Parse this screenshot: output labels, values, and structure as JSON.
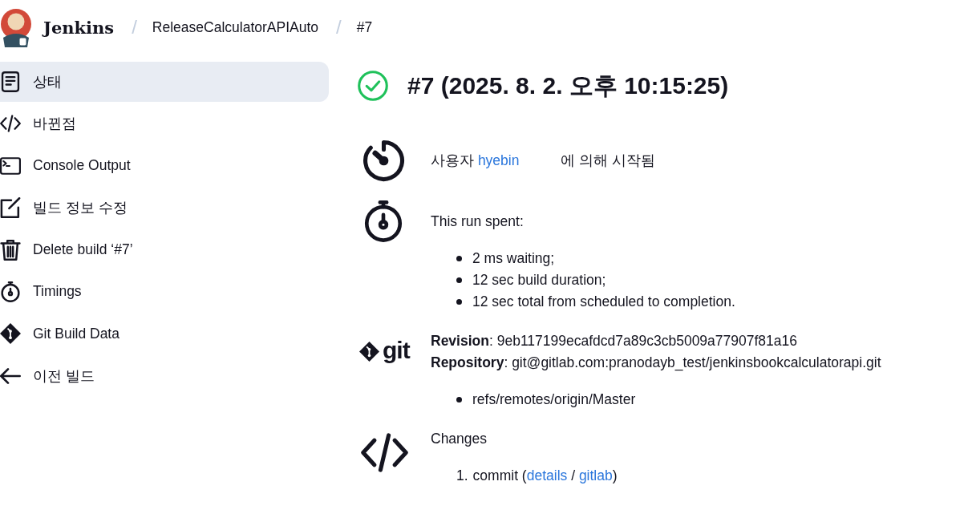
{
  "header": {
    "brand": "Jenkins",
    "breadcrumbs": [
      {
        "separator": "/",
        "label": "ReleaseCalculatorAPIAuto"
      },
      {
        "separator": "/",
        "label": "#7"
      }
    ]
  },
  "sidebar": {
    "items": [
      {
        "label": "상태",
        "selected": true
      },
      {
        "label": "바뀐점",
        "selected": false
      },
      {
        "label": "Console Output",
        "selected": false
      },
      {
        "label": "빌드 정보 수정",
        "selected": false
      },
      {
        "label": "Delete build ‘#7’",
        "selected": false
      },
      {
        "label": "Timings",
        "selected": false
      },
      {
        "label": "Git Build Data",
        "selected": false
      },
      {
        "label": "이전 빌드",
        "selected": false
      }
    ]
  },
  "build": {
    "passed": true,
    "title": "#7 (2025. 8. 2. 오후 10:15:25)"
  },
  "sections": [
    {
      "kind": "cause",
      "parts": [
        {
          "kind": "text",
          "text": "사용자 "
        },
        {
          "kind": "link",
          "text": "hyebin"
        },
        {
          "kind": "text",
          "text": "에 의해 시작됨"
        }
      ]
    },
    {
      "kind": "timing",
      "heading": "This run spent:",
      "items": [
        "2 ms waiting;",
        "12 sec build duration;",
        "12 sec total from scheduled to completion."
      ]
    },
    {
      "kind": "git",
      "logo_text": "git",
      "lines": [
        "**Revision**: 9eb117199ecafdcd7a89c3cb5009a77907f81a16",
        "**Repository**: git@gitlab.com:pranodayb_test/jenkinsbookcalculatorapi.git"
      ],
      "items": [
        "refs/remotes/origin/Master"
      ]
    },
    {
      "kind": "changes",
      "heading": "Changes",
      "entries": [
        {
          "number": "1.",
          "parts": [
            {
              "kind": "text",
              "text": "commit ("
            },
            {
              "kind": "link",
              "text": "details"
            },
            {
              "kind": "text",
              "text": " / "
            },
            {
              "kind": "link",
              "text": "gitlab"
            },
            {
              "kind": "text",
              "text": ")"
            }
          ]
        }
      ]
    }
  ]
}
